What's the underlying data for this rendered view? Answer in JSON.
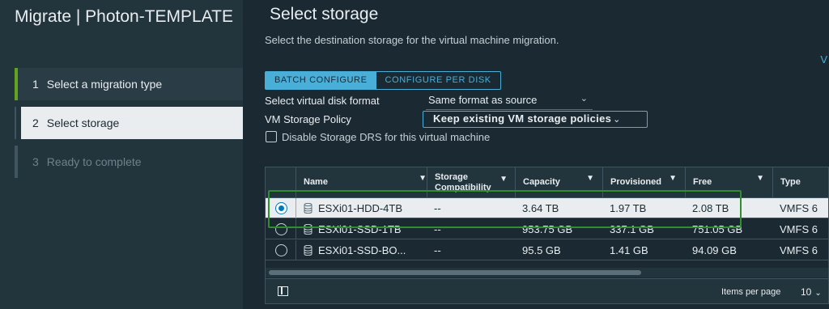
{
  "wizard": {
    "title": "Migrate | Photon-TEMPLATE",
    "steps": [
      {
        "num": "1",
        "label": "Select a migration type"
      },
      {
        "num": "2",
        "label": "Select storage"
      },
      {
        "num": "3",
        "label": "Ready to complete"
      }
    ]
  },
  "main": {
    "title": "Select storage",
    "subtitle": "Select the destination storage for the virtual machine migration.",
    "edge_link": "V",
    "tabs": {
      "batch": "BATCH CONFIGURE",
      "per_disk": "CONFIGURE PER DISK"
    },
    "disk_format": {
      "label": "Select virtual disk format",
      "value": "Same format as source"
    },
    "storage_policy": {
      "label": "VM Storage Policy",
      "value": "Keep existing VM storage policies"
    },
    "disable_drs": {
      "label": "Disable Storage DRS for this virtual machine",
      "checked": false
    }
  },
  "grid": {
    "columns": [
      "Name",
      "Storage Compatibility",
      "Capacity",
      "Provisioned",
      "Free",
      "Type"
    ],
    "rows": [
      {
        "name": "ESXi01-HDD-4TB",
        "compat": "--",
        "capacity": "3.64 TB",
        "provisioned": "1.97 TB",
        "free": "2.08 TB",
        "type": "VMFS 6",
        "selected": true
      },
      {
        "name": "ESXi01-SSD-1TB",
        "compat": "--",
        "capacity": "953.75 GB",
        "provisioned": "337.1 GB",
        "free": "751.05 GB",
        "type": "VMFS 6",
        "selected": false
      },
      {
        "name": "ESXi01-SSD-BO...",
        "compat": "--",
        "capacity": "95.5 GB",
        "provisioned": "1.41 GB",
        "free": "94.09 GB",
        "type": "VMFS 6",
        "selected": false
      }
    ],
    "footer": {
      "items_per_page_label": "Items per page",
      "items_per_page_value": "10"
    }
  },
  "colors": {
    "accent": "#49afd9",
    "done": "#62a420",
    "highlight": "#2f8f2f"
  }
}
